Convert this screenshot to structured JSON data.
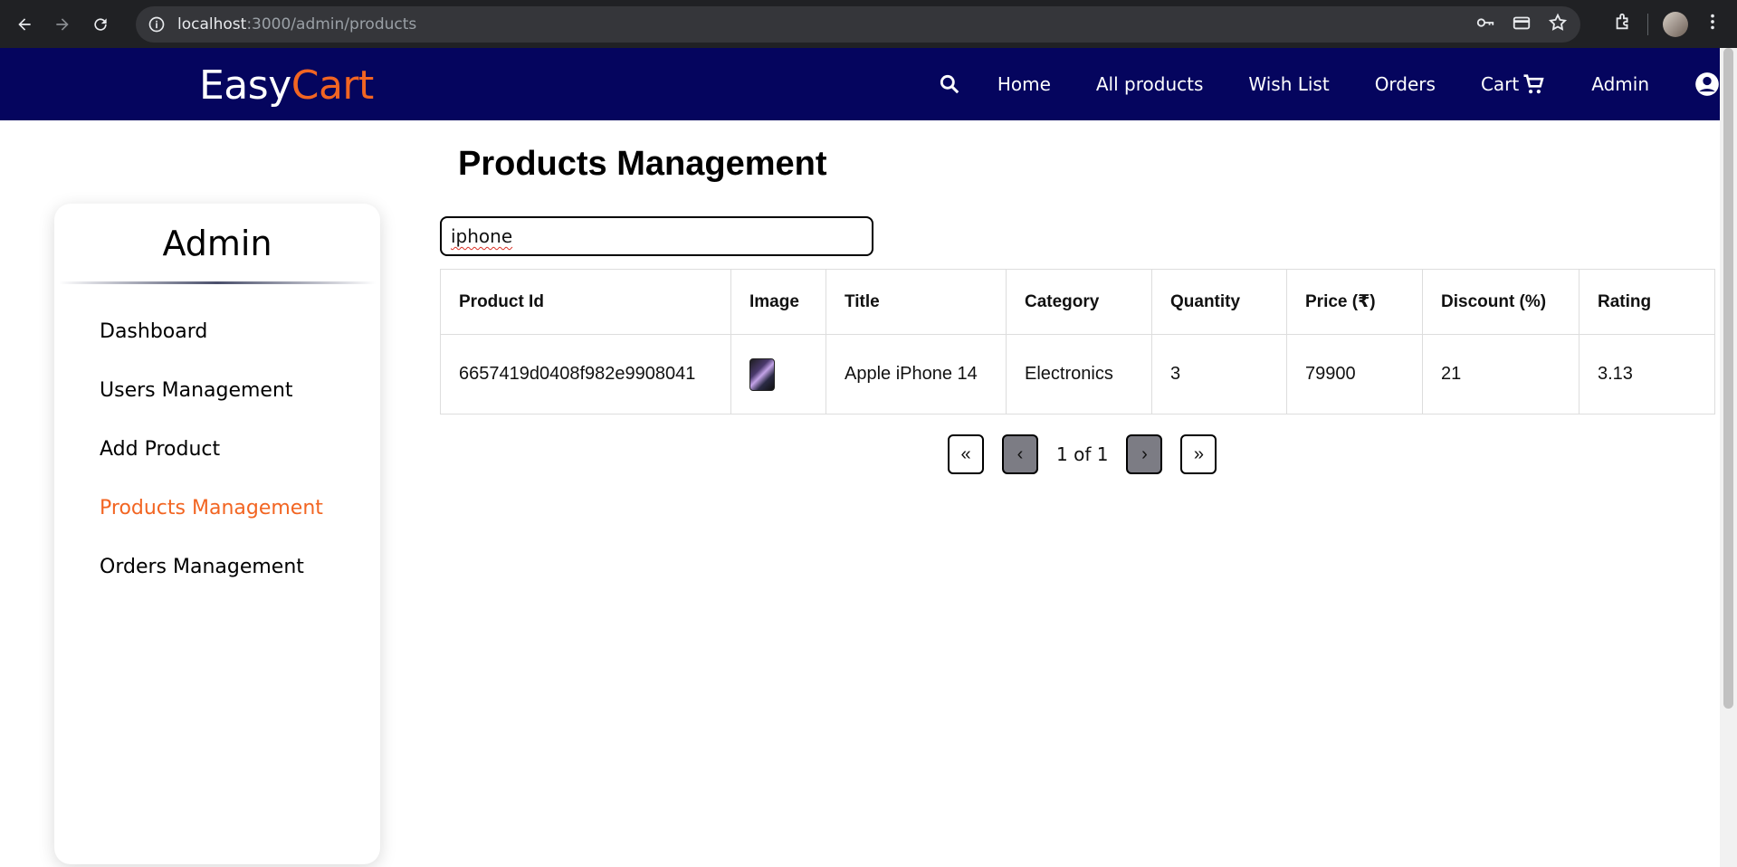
{
  "browser": {
    "url_host": "localhost",
    "url_rest": ":3000/admin/products"
  },
  "header": {
    "logo_part1": "Easy",
    "logo_part2": "Cart",
    "nav": [
      "Home",
      "All products",
      "Wish List",
      "Orders",
      "Cart",
      "Admin"
    ]
  },
  "sidebar": {
    "title": "Admin",
    "items": [
      {
        "label": "Dashboard"
      },
      {
        "label": "Users Management"
      },
      {
        "label": "Add Product"
      },
      {
        "label": "Products Management"
      },
      {
        "label": "Orders Management"
      }
    ],
    "active_index": 3
  },
  "main": {
    "title": "Products Management",
    "search_value": "iphone",
    "table": {
      "headers": [
        "Product Id",
        "Image",
        "Title",
        "Category",
        "Quantity",
        "Price (₹)",
        "Discount (%)",
        "Rating"
      ],
      "rows": [
        {
          "id": "6657419d0408f982e9908041",
          "title": "Apple iPhone 14",
          "category": "Electronics",
          "quantity": "3",
          "price": "79900",
          "discount": "21",
          "rating": "3.13"
        }
      ]
    },
    "pagination": {
      "first": "«",
      "prev": "‹",
      "info": "1 of 1",
      "next": "›",
      "last": "»"
    }
  },
  "colors": {
    "appbar": "#05055e",
    "accent": "#f26522"
  }
}
